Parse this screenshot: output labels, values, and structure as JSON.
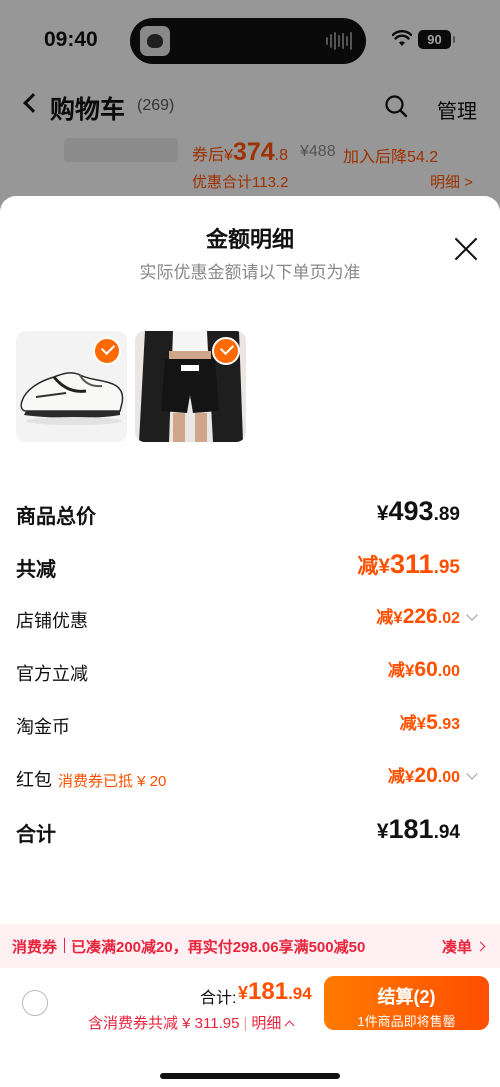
{
  "status_bar": {
    "time": "09:40",
    "battery": "90"
  },
  "nav": {
    "title": "购物车",
    "count": "(269)",
    "manage": "管理"
  },
  "background_item": {
    "after_coupon_prefix": "券后",
    "after_coupon_currency": "¥",
    "after_coupon_int": "374",
    "after_coupon_dec": ".8",
    "original_price": "¥488",
    "price_drop": "加入后降54.2",
    "discount_total": "优惠合计113.2",
    "detail_link": "明细 >"
  },
  "sheet": {
    "title": "金额明细",
    "subtitle": "实际优惠金额请以下单页为准",
    "products": [
      {
        "name": "white-sneaker",
        "selected": true
      },
      {
        "name": "black-shorts-outfit",
        "selected": true
      }
    ],
    "rows": [
      {
        "label": "商品总价",
        "cur": "¥",
        "int": "493",
        "dec": ".89"
      },
      {
        "label": "共减",
        "prefix": "减",
        "cur": "¥",
        "int": "311",
        "dec": ".95"
      },
      {
        "label": "店铺优惠",
        "prefix": "减",
        "cur": "¥",
        "int": "226",
        "dec": ".02"
      },
      {
        "label": "官方立减",
        "prefix": "减",
        "cur": "¥",
        "int": "60",
        "dec": ".00"
      },
      {
        "label": "淘金币",
        "prefix": "减",
        "cur": "¥",
        "int": "5",
        "dec": ".93"
      },
      {
        "label": "红包",
        "note": "消费券已抵 ¥ 20",
        "prefix": "减",
        "cur": "¥",
        "int": "20",
        "dec": ".00"
      },
      {
        "label": "合计",
        "cur": "¥",
        "int": "181",
        "dec": ".94"
      }
    ]
  },
  "promo": {
    "tag": "消费券",
    "text": "已凑满200减20，再实付298.06享满500减50",
    "link": "凑单"
  },
  "bottom": {
    "total_label": "合计:",
    "total_cur": "¥",
    "total_int": "181",
    "total_dec": ".94",
    "discount_text": "含消费券共减 ¥ 311.95",
    "detail_link": "明细",
    "checkout_label": "结算(2)",
    "checkout_sub": "1件商品即将售罄"
  },
  "colors": {
    "accent": "#ff5000",
    "promo_red": "#e8243c",
    "promo_bg": "#fff0f3"
  }
}
